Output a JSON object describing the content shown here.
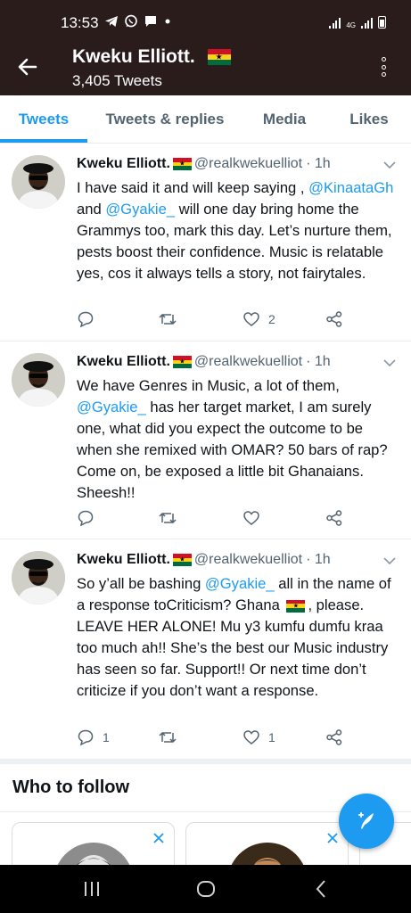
{
  "status_bar": {
    "time": "13:53",
    "network_label": "4G"
  },
  "header": {
    "name": "Kweku Elliott.",
    "tweet_count": "3,405 Tweets"
  },
  "tabs": [
    {
      "label": "Tweets",
      "active": true
    },
    {
      "label": "Tweets & replies",
      "active": false
    },
    {
      "label": "Media",
      "active": false
    },
    {
      "label": "Likes",
      "active": false
    }
  ],
  "tweets": [
    {
      "name": "Kweku Elliott.",
      "handle": "@realkwekuelliot",
      "time": "· 1h",
      "text": {
        "p1": "I have said it and will keep saying ,",
        "m1": "@KinaataGh",
        "p2": "and",
        "m2": "@Gyakie_",
        "p3": "will one day bring home the Grammys too, mark this day. Let’s nurture them, pests boost their confidence. Music is relatable yes, cos it always tells a story, not fairytales."
      },
      "replies": "",
      "retweets": "",
      "likes": "2"
    },
    {
      "name": "Kweku Elliott.",
      "handle": "@realkwekuelliot",
      "time": "· 1h",
      "text": {
        "p1": "We have Genres in Music, a lot of them,",
        "m1": "@Gyakie_",
        "p2": "has her target market, I am surely one, what did you expect the outcome to be when she remixed with OMAR? 50 bars of rap? Come on, be exposed a little bit Ghanaians. Sheesh!!"
      },
      "replies": "",
      "retweets": "",
      "likes": ""
    },
    {
      "name": "Kweku Elliott.",
      "handle": "@realkwekuelliot",
      "time": "· 1h",
      "text": {
        "p1": "So y’all be bashing",
        "m1": "@Gyakie_",
        "p2": "all in the name of a response toCriticism? Ghana",
        "p3": ", please. LEAVE HER ALONE! Mu y3 kumfu dumfu kraa too much ah!! She’s the best our Music industry has seen so far. Support!! Or next time don’t criticize if you don’t want a response."
      },
      "replies": "1",
      "retweets": "",
      "likes": "1"
    }
  ],
  "who_to_follow": {
    "title": "Who to follow"
  },
  "icons": {
    "back": "arrow-left-icon",
    "overflow": "more-vertical-icon",
    "caret": "chevron-down-icon",
    "reply": "reply-icon",
    "retweet": "retweet-icon",
    "like": "heart-icon",
    "share": "share-icon",
    "compose": "compose-tweet-icon",
    "close": "close-icon"
  },
  "colors": {
    "header_bg": "#2b1c1c",
    "accent": "#1d9bf0",
    "muted": "#536471"
  }
}
